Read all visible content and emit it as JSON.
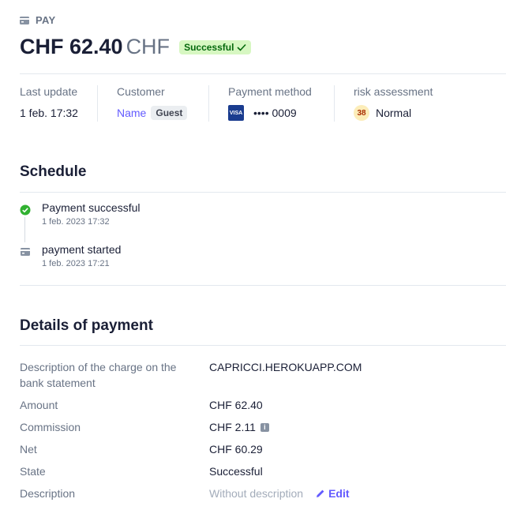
{
  "header": {
    "kicker": "PAY",
    "amount": "CHF 62.40",
    "currency": "CHF",
    "status_badge": "Successful"
  },
  "summary": {
    "last_update": {
      "label": "Last update",
      "value": "1 feb. 17:32"
    },
    "customer": {
      "label": "Customer",
      "name": "Name",
      "tag": "Guest"
    },
    "payment_method": {
      "label": "Payment method",
      "card_brand": "VISA",
      "masked": "•••• 0009"
    },
    "risk": {
      "label": "risk assessment",
      "score": "38",
      "level": "Normal"
    }
  },
  "schedule": {
    "title": "Schedule",
    "events": [
      {
        "title": "Payment successful",
        "time": "1 feb. 2023 17:32",
        "icon": "check-circle-icon"
      },
      {
        "title": "payment started",
        "time": "1 feb. 2023 17:21",
        "icon": "payment-icon"
      }
    ]
  },
  "details": {
    "title": "Details of payment",
    "rows": [
      {
        "label": "Description of the charge on the bank statement",
        "value": "CAPRICCI.HEROKUAPP.COM"
      },
      {
        "label": "Amount",
        "value": "CHF 62.40"
      },
      {
        "label": "Commission",
        "value": "CHF 2.11"
      },
      {
        "label": "Net",
        "value": "CHF 60.29"
      },
      {
        "label": "State",
        "value": "Successful"
      },
      {
        "label": "Description",
        "value": "Without description",
        "action": "Edit"
      }
    ]
  },
  "colors": {
    "accent": "#635bff",
    "success_bg": "#d7f7c2",
    "success_text": "#05690d",
    "muted": "#687385"
  }
}
